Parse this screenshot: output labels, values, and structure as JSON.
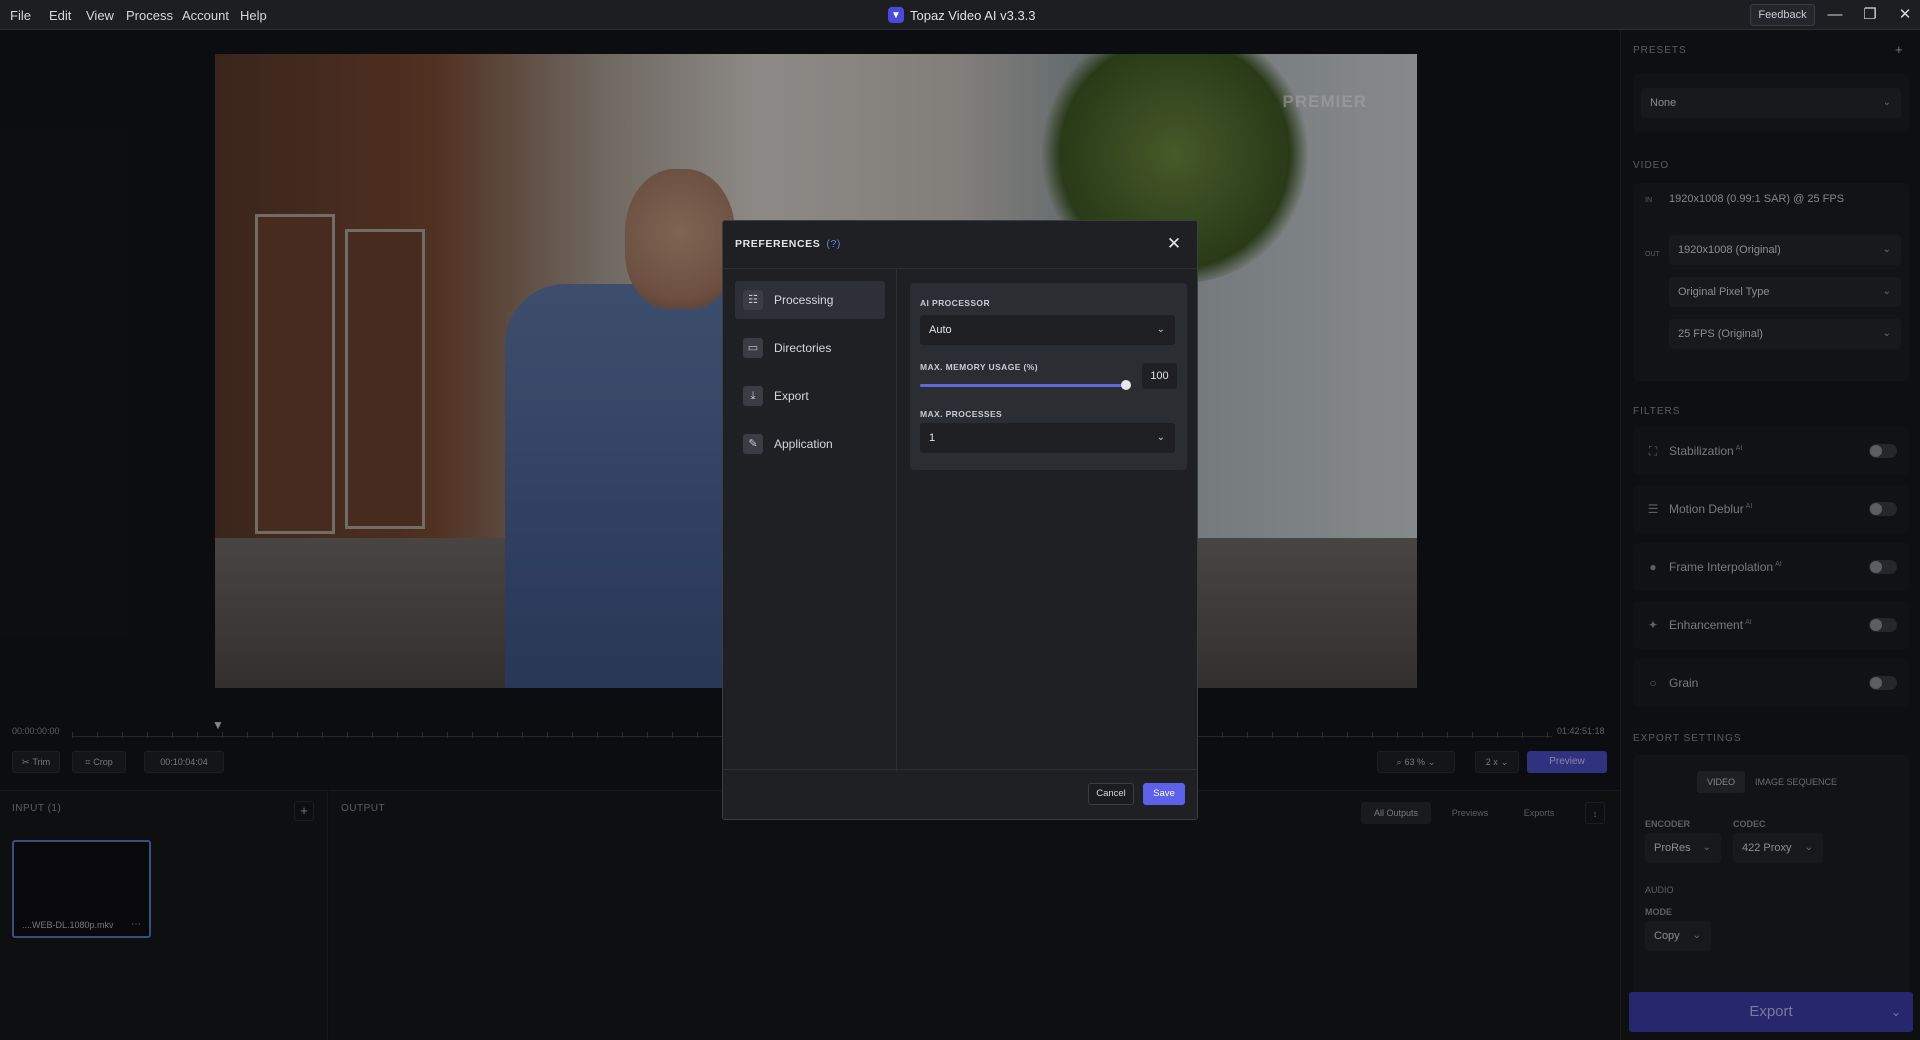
{
  "menubar": {
    "items": [
      "File",
      "Edit",
      "View",
      "Process",
      "Account",
      "Help"
    ],
    "app_title": "Topaz Video AI  v3.3.3",
    "feedback_label": "Feedback"
  },
  "viewer": {
    "watermark": "PREMIER"
  },
  "timeline": {
    "start_time": "00:00:00:00",
    "end_time": "01:42:51:18",
    "trim_label": "Trim",
    "crop_label": "Crop",
    "current_time": "00:10:04:04",
    "zoom_value": "63 %",
    "speed_value": "2 x",
    "preview_label": "Preview"
  },
  "input_panel": {
    "title": "INPUT (1)",
    "file_name": "....WEB-DL.1080p.mkv"
  },
  "output_panel": {
    "title": "OUTPUT",
    "tabs": [
      "All Outputs",
      "Previews",
      "Exports"
    ]
  },
  "sidebar": {
    "presets_title": "PRESETS",
    "preset_value": "None",
    "video_title": "VIDEO",
    "in_tag": "IN",
    "in_info": "1920x1008 (0.99:1 SAR) @ 25 FPS",
    "out_tag": "OUT",
    "out_resolution": "1920x1008 (Original)",
    "pixel_type": "Original Pixel Type",
    "fps": "25 FPS (Original)",
    "filters_title": "FILTERS",
    "filters": [
      {
        "label": "Stabilization",
        "sup": "AI",
        "icon": "stabilization-icon"
      },
      {
        "label": "Motion Deblur",
        "sup": "AI",
        "icon": "deblur-icon"
      },
      {
        "label": "Frame Interpolation",
        "sup": "AI",
        "icon": "interpolation-icon"
      },
      {
        "label": "Enhancement",
        "sup": "AI",
        "icon": "sparkle-icon"
      },
      {
        "label": "Grain",
        "sup": "",
        "icon": "grain-icon"
      }
    ],
    "export_title": "EXPORT SETTINGS",
    "export_tabs": [
      "VIDEO",
      "IMAGE SEQUENCE"
    ],
    "encoder_label": "ENCODER",
    "encoder_value": "ProRes",
    "codec_label": "CODEC",
    "codec_value": "422 Proxy",
    "audio_label": "AUDIO",
    "mode_label": "MODE",
    "mode_value": "Copy",
    "export_label": "Export"
  },
  "dialog": {
    "title": "PREFERENCES",
    "help": "(?)",
    "nav": [
      "Processing",
      "Directories",
      "Export",
      "Application"
    ],
    "active_nav": "Processing",
    "ai_processor_label": "AI PROCESSOR",
    "ai_processor_value": "Auto",
    "memory_label": "MAX. MEMORY USAGE (%)",
    "memory_value": "100",
    "memory_fraction": 1.0,
    "processes_label": "MAX. PROCESSES",
    "processes_value": "1",
    "cancel_label": "Cancel",
    "save_label": "Save"
  },
  "colors": {
    "accent": "#5d60e8",
    "export": "#3b3da8"
  }
}
